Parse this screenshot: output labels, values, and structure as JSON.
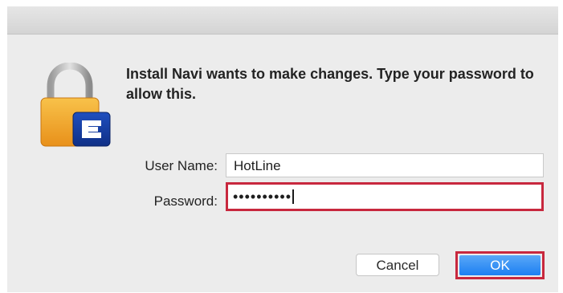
{
  "dialog": {
    "message": "Install Navi wants to make changes. Type your password to allow this.",
    "icon": "lock-app-icon",
    "badge_letter": "E",
    "accent_color": "#1c7ff2",
    "highlight_color": "#c8283e"
  },
  "form": {
    "username_label": "User Name:",
    "username_value": "HotLine",
    "password_label": "Password:",
    "password_value": "••••••••••"
  },
  "buttons": {
    "cancel_label": "Cancel",
    "ok_label": "OK"
  }
}
